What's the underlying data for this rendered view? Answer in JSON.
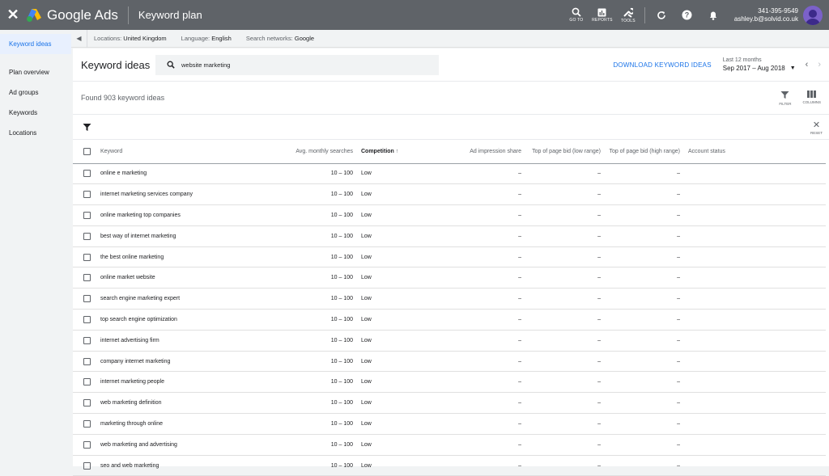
{
  "topbar": {
    "app_name": "Google Ads",
    "page_title": "Keyword plan",
    "icons": [
      {
        "name": "search-icon",
        "label": "GO TO"
      },
      {
        "name": "reports-icon",
        "label": "REPORTS"
      },
      {
        "name": "tools-icon",
        "label": "TOOLS"
      }
    ],
    "account_id": "341-395-9549",
    "account_email": "ashley.b@solvid.co.uk"
  },
  "sidebar": {
    "items": [
      {
        "label": "Keyword ideas",
        "active": true
      },
      {
        "label": "Plan overview",
        "active": false
      },
      {
        "label": "Ad groups",
        "active": false
      },
      {
        "label": "Keywords",
        "active": false
      },
      {
        "label": "Locations",
        "active": false
      }
    ]
  },
  "filterbar": {
    "location_label": "Locations:",
    "location_value": "United Kingdom",
    "language_label": "Language:",
    "language_value": "English",
    "network_label": "Search networks:",
    "network_value": "Google"
  },
  "header": {
    "title": "Keyword ideas",
    "search_value": "website marketing",
    "download_label": "DOWNLOAD KEYWORD IDEAS",
    "range_label": "Last 12 months",
    "range_value": "Sep 2017 – Aug 2018"
  },
  "results": {
    "found_text": "Found 903 keyword ideas",
    "filter_label": "FILTER",
    "columns_label": "COLUMNS",
    "reset_label": "RESET"
  },
  "table": {
    "headers": {
      "keyword": "Keyword",
      "searches": "Avg. monthly searches",
      "competition": "Competition",
      "impression": "Ad impression share",
      "bid_low": "Top of page bid (low range)",
      "bid_high": "Top of page bid (high range)",
      "status": "Account status"
    },
    "rows": [
      {
        "keyword": "online e marketing",
        "searches": "10 – 100",
        "competition": "Low",
        "impression": "–",
        "bid_low": "–",
        "bid_high": "–"
      },
      {
        "keyword": "internet marketing services company",
        "searches": "10 – 100",
        "competition": "Low",
        "impression": "–",
        "bid_low": "–",
        "bid_high": "–"
      },
      {
        "keyword": "online marketing top companies",
        "searches": "10 – 100",
        "competition": "Low",
        "impression": "–",
        "bid_low": "–",
        "bid_high": "–"
      },
      {
        "keyword": "best way of internet marketing",
        "searches": "10 – 100",
        "competition": "Low",
        "impression": "–",
        "bid_low": "–",
        "bid_high": "–"
      },
      {
        "keyword": "the best online marketing",
        "searches": "10 – 100",
        "competition": "Low",
        "impression": "–",
        "bid_low": "–",
        "bid_high": "–"
      },
      {
        "keyword": "online market website",
        "searches": "10 – 100",
        "competition": "Low",
        "impression": "–",
        "bid_low": "–",
        "bid_high": "–"
      },
      {
        "keyword": "search engine marketing expert",
        "searches": "10 – 100",
        "competition": "Low",
        "impression": "–",
        "bid_low": "–",
        "bid_high": "–"
      },
      {
        "keyword": "top search engine optimization",
        "searches": "10 – 100",
        "competition": "Low",
        "impression": "–",
        "bid_low": "–",
        "bid_high": "–"
      },
      {
        "keyword": "internet advertising firm",
        "searches": "10 – 100",
        "competition": "Low",
        "impression": "–",
        "bid_low": "–",
        "bid_high": "–"
      },
      {
        "keyword": "company internet marketing",
        "searches": "10 – 100",
        "competition": "Low",
        "impression": "–",
        "bid_low": "–",
        "bid_high": "–"
      },
      {
        "keyword": "internet marketing people",
        "searches": "10 – 100",
        "competition": "Low",
        "impression": "–",
        "bid_low": "–",
        "bid_high": "–"
      },
      {
        "keyword": "web marketing definition",
        "searches": "10 – 100",
        "competition": "Low",
        "impression": "–",
        "bid_low": "–",
        "bid_high": "–"
      },
      {
        "keyword": "marketing through online",
        "searches": "10 – 100",
        "competition": "Low",
        "impression": "–",
        "bid_low": "–",
        "bid_high": "–"
      },
      {
        "keyword": "web marketing and advertising",
        "searches": "10 – 100",
        "competition": "Low",
        "impression": "–",
        "bid_low": "–",
        "bid_high": "–"
      },
      {
        "keyword": "seo and web marketing",
        "searches": "10 – 100",
        "competition": "Low",
        "impression": "–",
        "bid_low": "–",
        "bid_high": "–"
      }
    ]
  },
  "colors": {
    "topbar": "#5f6368",
    "accent": "#1a73e8",
    "sidebar_active_bg": "#e8f0fe"
  }
}
